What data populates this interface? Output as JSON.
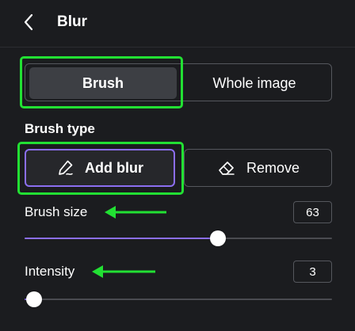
{
  "header": {
    "title": "Blur",
    "back_icon": "chevron-left-icon"
  },
  "mode_tabs": {
    "brush_label": "Brush",
    "whole_image_label": "Whole image",
    "selected": "Brush"
  },
  "brush_type": {
    "label": "Brush type",
    "add_label": "Add blur",
    "add_icon": "brush-icon",
    "remove_label": "Remove",
    "remove_icon": "eraser-icon",
    "selected": "Add blur"
  },
  "brush_size": {
    "label": "Brush size",
    "value": "63",
    "slider_fraction": 0.63
  },
  "intensity": {
    "label": "Intensity",
    "value": "3",
    "slider_fraction": 0.03
  },
  "colors": {
    "background": "#1b1c1f",
    "accent": "#8b6ef0",
    "highlight": "#22e033"
  }
}
